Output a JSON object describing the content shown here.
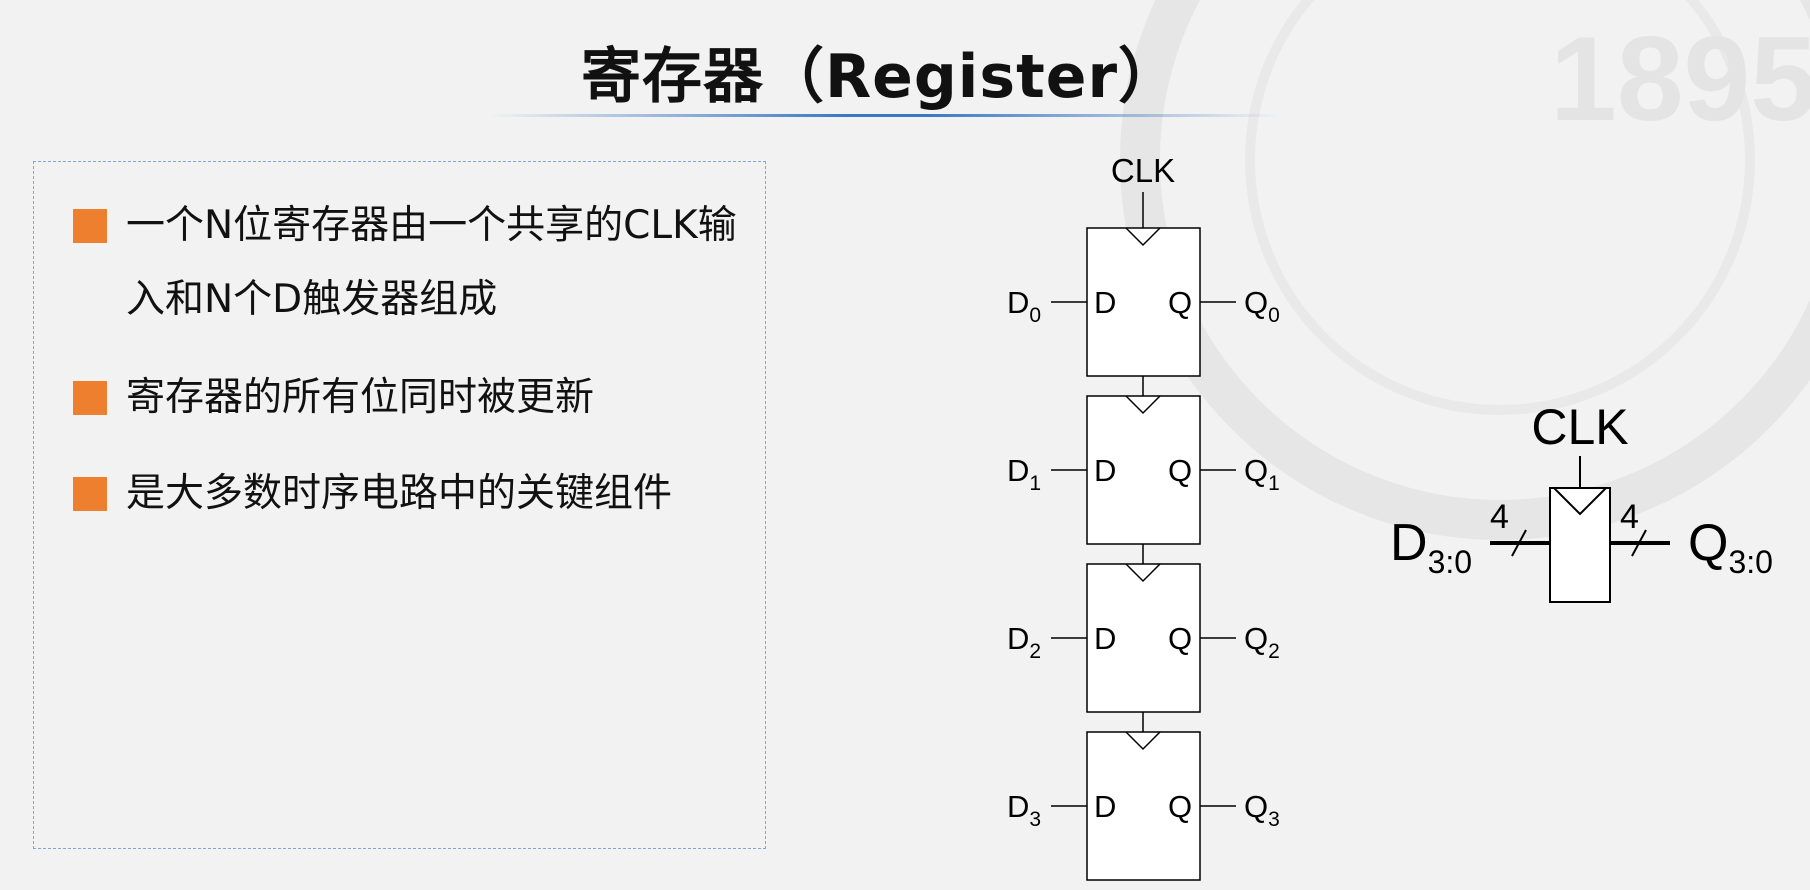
{
  "slide": {
    "title": "寄存器（Register）"
  },
  "bullets": [
    {
      "text": "一个N位寄存器由一个共享的CLK输入和N个D触发器组成"
    },
    {
      "text": "寄存器的所有位同时被更新"
    },
    {
      "text": "是大多数时序电路中的关键组件"
    }
  ],
  "diagram_stack": {
    "clk_label": "CLK",
    "flipflops": [
      {
        "in_main": "D",
        "in_sub": "0",
        "d_pin": "D",
        "q_pin": "Q",
        "out_main": "Q",
        "out_sub": "0"
      },
      {
        "in_main": "D",
        "in_sub": "1",
        "d_pin": "D",
        "q_pin": "Q",
        "out_main": "Q",
        "out_sub": "1"
      },
      {
        "in_main": "D",
        "in_sub": "2",
        "d_pin": "D",
        "q_pin": "Q",
        "out_main": "Q",
        "out_sub": "2"
      },
      {
        "in_main": "D",
        "in_sub": "3",
        "d_pin": "D",
        "q_pin": "Q",
        "out_main": "Q",
        "out_sub": "3"
      }
    ]
  },
  "diagram_symbol": {
    "clk_label": "CLK",
    "in_main": "D",
    "in_sub": "3:0",
    "out_main": "Q",
    "out_sub": "3:0",
    "in_width": "4",
    "out_width": "4"
  },
  "watermark": {
    "year": "1895"
  },
  "colors": {
    "background": "#f2f2f2",
    "bullet_marker": "#ee7f2f",
    "title_rule": "#3a78c4",
    "box_border": "#7fa6d6"
  }
}
